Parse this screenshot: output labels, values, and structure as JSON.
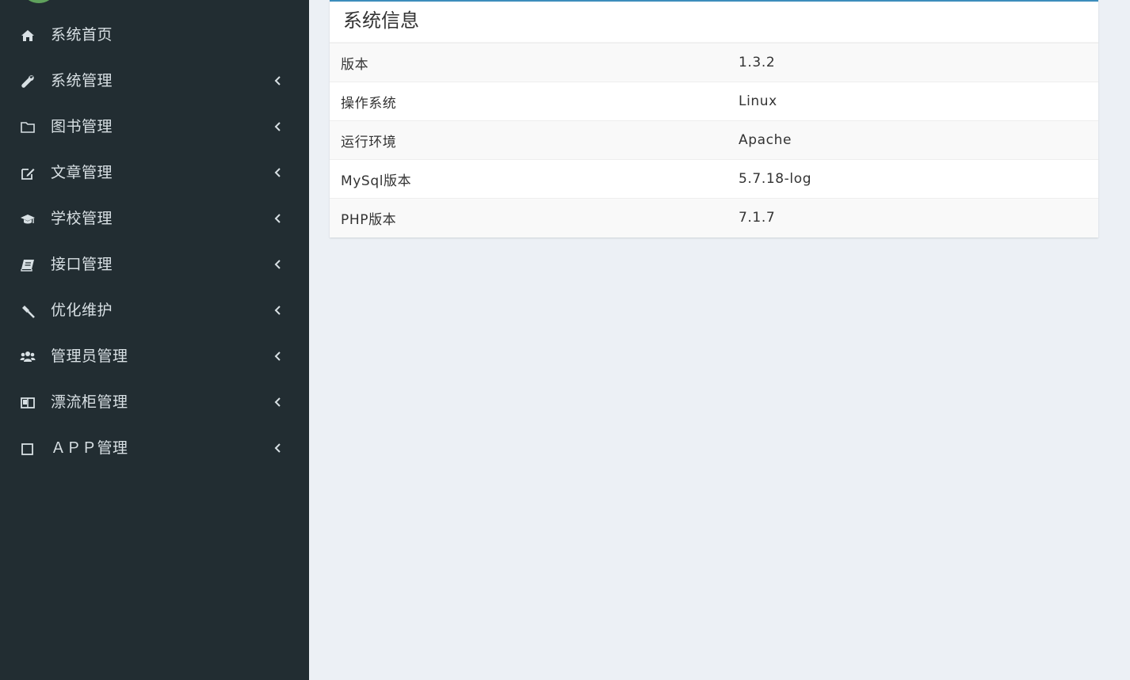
{
  "sidebar": {
    "items": [
      {
        "label": "系统首页",
        "icon": "home-icon",
        "has_submenu": false
      },
      {
        "label": "系统管理",
        "icon": "wrench-icon",
        "has_submenu": true
      },
      {
        "label": "图书管理",
        "icon": "folder-icon",
        "has_submenu": true
      },
      {
        "label": "文章管理",
        "icon": "edit-icon",
        "has_submenu": true
      },
      {
        "label": "学校管理",
        "icon": "graduation-cap-icon",
        "has_submenu": true
      },
      {
        "label": "接口管理",
        "icon": "book-icon",
        "has_submenu": true
      },
      {
        "label": "优化维护",
        "icon": "gavel-icon",
        "has_submenu": true
      },
      {
        "label": "管理员管理",
        "icon": "users-icon",
        "has_submenu": true
      },
      {
        "label": "漂流柜管理",
        "icon": "columns-icon",
        "has_submenu": true
      },
      {
        "label": "ＡＰＰ管理",
        "icon": "square-icon",
        "has_submenu": true
      }
    ]
  },
  "main": {
    "box_title": "系统信息",
    "rows": [
      {
        "key": "版本",
        "value": "1.3.2"
      },
      {
        "key": "操作系统",
        "value": "Linux"
      },
      {
        "key": "运行环境",
        "value": "Apache"
      },
      {
        "key": "MySql版本",
        "value": "5.7.18-log"
      },
      {
        "key": "PHP版本",
        "value": "7.1.7"
      }
    ]
  },
  "colors": {
    "sidebar_bg": "#222d32",
    "content_bg": "#ecf0f5",
    "box_border_accent": "#3c8dbc",
    "menu_text": "#d8e0e4"
  }
}
